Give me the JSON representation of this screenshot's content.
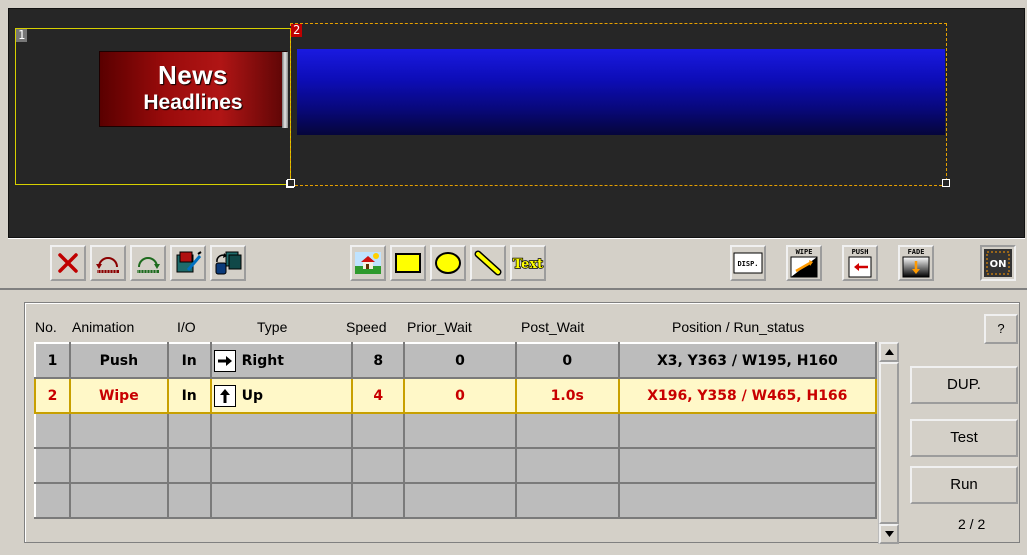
{
  "preview": {
    "zone1_number": "1",
    "zone2_number": "2",
    "news_title_line1": "News",
    "news_title_line2": "Headlines",
    "zone1_border_color": "#d6d000",
    "zone2_border_color": "#e8a000",
    "background_color": "#262626"
  },
  "toolbar": {
    "buttons": [
      {
        "name": "delete",
        "icon": "red-x-icon"
      },
      {
        "name": "undo",
        "icon": "undo-arc-icon"
      },
      {
        "name": "redo",
        "icon": "redo-arc-icon"
      },
      {
        "name": "paint-color",
        "icon": "paint-color-icon"
      },
      {
        "name": "layer-order",
        "icon": "layer-order-icon"
      },
      {
        "name": "image",
        "icon": "image-picture-icon"
      },
      {
        "name": "rectangle",
        "icon": "rectangle-shape-icon"
      },
      {
        "name": "ellipse",
        "icon": "ellipse-shape-icon"
      },
      {
        "name": "line",
        "icon": "line-shape-icon"
      },
      {
        "name": "text",
        "icon": "text-tool-icon",
        "label": "Text"
      },
      {
        "name": "disp",
        "icon": "display-icon",
        "label": "DISP."
      },
      {
        "name": "wipe",
        "icon": "wipe-effect-icon",
        "label": "WIPE"
      },
      {
        "name": "push",
        "icon": "push-effect-icon",
        "label": "PUSH"
      },
      {
        "name": "fade",
        "icon": "fade-effect-icon",
        "label": "FADE"
      },
      {
        "name": "on",
        "icon": "on-toggle-icon",
        "label": "ON"
      }
    ]
  },
  "grid": {
    "headers": {
      "no": "No.",
      "animation": "Animation",
      "io": "I/O",
      "type": "Type",
      "speed": "Speed",
      "prior_wait": "Prior_Wait",
      "post_wait": "Post_Wait",
      "position": "Position / Run_status"
    },
    "rows": [
      {
        "no": "1",
        "animation": "Push",
        "io": "In",
        "arrow": "→",
        "type": "Right",
        "speed": "8",
        "prior_wait": "0",
        "post_wait": "0",
        "position": "X3, Y363 / W195, H160"
      },
      {
        "no": "2",
        "animation": "Wipe",
        "io": "In",
        "arrow": "🡅",
        "type": "Up",
        "speed": "4",
        "prior_wait": "0",
        "post_wait": "1.0s",
        "position": "X196, Y358 / W465, H166"
      }
    ],
    "selected_row_color": "#fff8c8",
    "selected_text_color": "#c80000"
  },
  "side": {
    "help_label": "?",
    "dup_label": "DUP.",
    "test_label": "Test",
    "run_label": "Run",
    "page_indicator": "2 / 2"
  }
}
